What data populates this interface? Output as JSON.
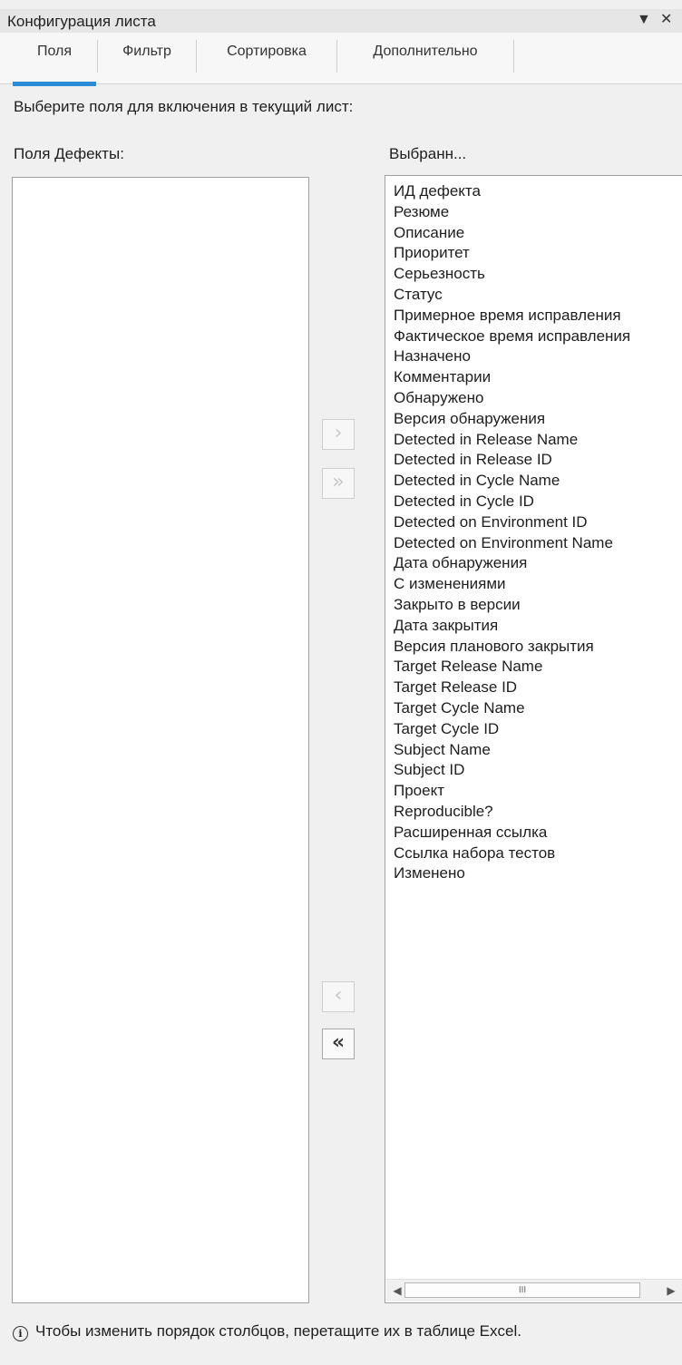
{
  "window": {
    "title": "Конфигурация листа",
    "dropdown_icon": "▼",
    "close_icon": "✕"
  },
  "tabs": [
    {
      "label": "Поля",
      "selected": true
    },
    {
      "label": "Фильтр",
      "selected": false
    },
    {
      "label": "Сортировка",
      "selected": false
    },
    {
      "label": "Дополнительно",
      "selected": false
    }
  ],
  "accent_color": "#2a8ad4",
  "instruction": "Выберите поля для включения в текущий лист:",
  "available": {
    "label": "Поля Дефекты:",
    "items": []
  },
  "selected": {
    "label": "Выбранн...",
    "items": [
      "ИД дефекта",
      "Резюме",
      "Описание",
      "Приоритет",
      "Серьезность",
      "Статус",
      "Примерное время исправления",
      "Фактическое время исправления",
      "Назначено",
      "Комментарии",
      "Обнаружено",
      "Версия обнаружения",
      "Detected in Release Name",
      "Detected in Release ID",
      "Detected in Cycle Name",
      "Detected in Cycle ID",
      "Detected on Environment ID",
      "Detected on Environment Name",
      "Дата обнаружения",
      "С изменениями",
      "Закрыто в версии",
      "Дата закрытия",
      "Версия планового закрытия",
      "Target Release Name",
      "Target Release ID",
      "Target Cycle Name",
      "Target Cycle ID",
      "Subject Name",
      "Subject ID",
      "Проект",
      "Reproducible?",
      "Расширенная ссылка",
      "Ссылка набора тестов",
      "Изменено"
    ]
  },
  "buttons": {
    "add": "›",
    "add_all": "»",
    "remove": "‹",
    "remove_all": "«"
  },
  "scrollbar": {
    "left_arrow": "◀",
    "right_arrow": "▶",
    "grip": "III"
  },
  "footer": {
    "icon": "i",
    "text": "Чтобы изменить порядок столбцов, перетащите их в таблице Excel."
  }
}
